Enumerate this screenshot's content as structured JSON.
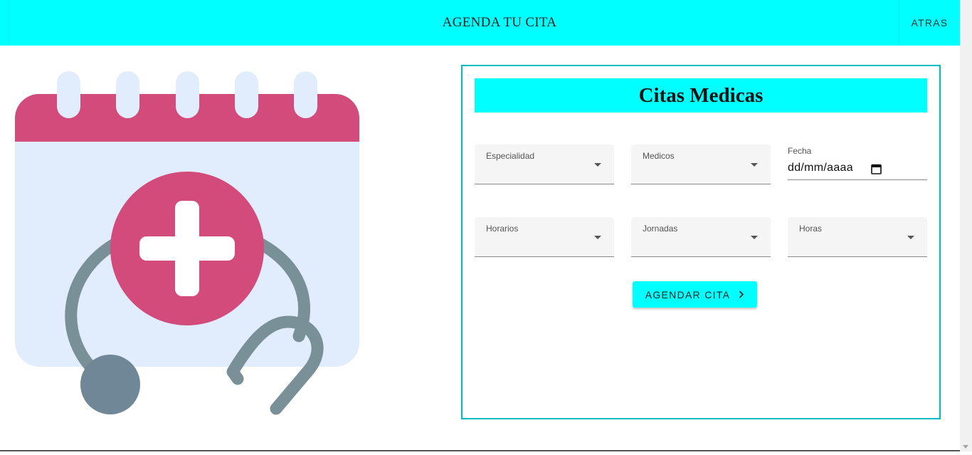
{
  "header": {
    "title": "AGENDA TU CITA",
    "back_label": "ATRAS"
  },
  "form": {
    "title": "Citas Medicas",
    "fields": {
      "especialidad": "Especialidad",
      "medicos": "Medicos",
      "fecha_label": "Fecha",
      "fecha_value": "dd/mm/aaaa",
      "horarios": "Horarios",
      "jornadas": "Jornadas",
      "horas": "Horas"
    },
    "submit_label": "AGENDAR CITA"
  },
  "colors": {
    "accent": "#00ffff",
    "card_border": "#00bcc4",
    "calendar_top": "#d24b7a",
    "calendar_body": "#e1edfc",
    "stethoscope": "#7a9099"
  },
  "icons": {
    "illustration": "calendar-medical-icon",
    "date_picker": "calendar-icon",
    "dropdown": "chevron-down-icon",
    "submit": "chevron-right-icon"
  }
}
